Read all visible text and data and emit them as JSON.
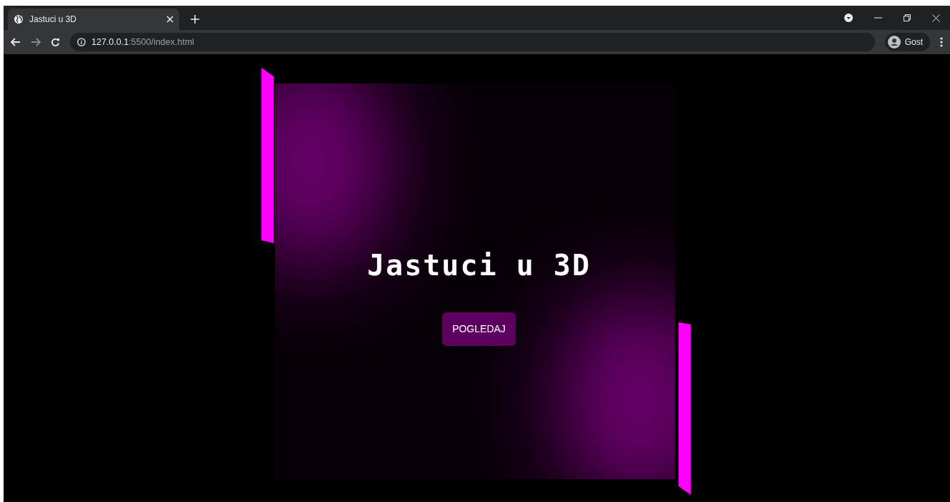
{
  "tabs": [
    {
      "title": "Jastuci u 3D",
      "selected": true
    }
  ],
  "address_bar": {
    "host": "127.0.0.1",
    "path": ":5500/index.html"
  },
  "profile": {
    "label": "Gost"
  },
  "page": {
    "heading": "Jastuci u 3D",
    "button": "POGLEDAJ"
  }
}
